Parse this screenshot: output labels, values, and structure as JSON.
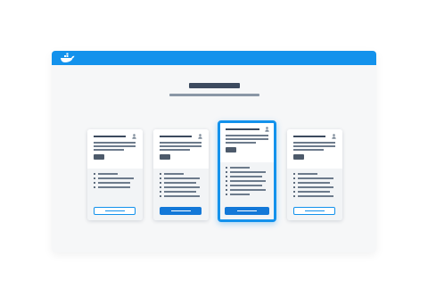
{
  "app": {
    "brand_color": "#1392ec",
    "logo_icon": "docker-whale-icon"
  },
  "page": {
    "heading": "",
    "subheading": ""
  },
  "plans": [
    {
      "name": "",
      "button_style": "outline",
      "featured": false,
      "feature_count": 4
    },
    {
      "name": "",
      "button_style": "solid",
      "featured": false,
      "feature_count": 6
    },
    {
      "name": "",
      "button_style": "solid",
      "featured": true,
      "feature_count": 7
    },
    {
      "name": "",
      "button_style": "outline",
      "featured": false,
      "feature_count": 6
    }
  ]
}
